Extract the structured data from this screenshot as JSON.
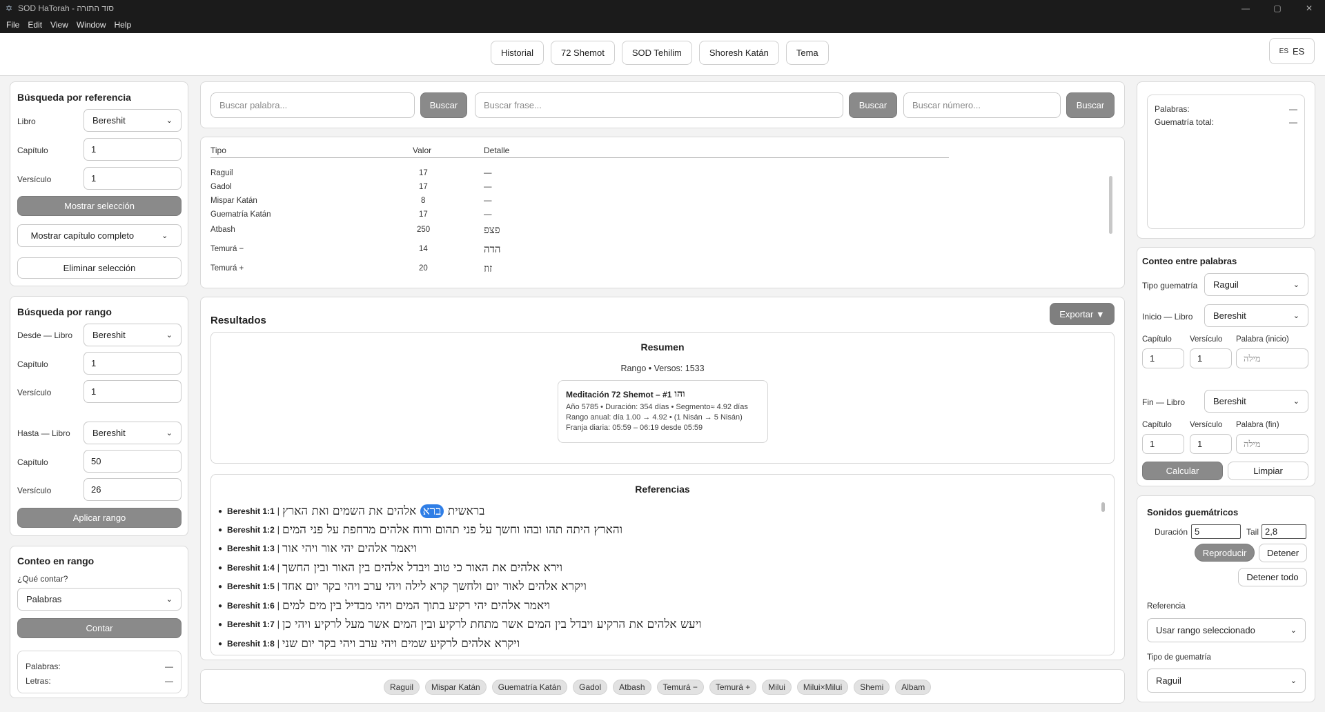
{
  "window": {
    "title": "SOD HaTorah - סוד התורה",
    "minimize": "—",
    "maximize": "▢",
    "close": "✕"
  },
  "menu": [
    "File",
    "Edit",
    "View",
    "Window",
    "Help"
  ],
  "toolbar": {
    "tabs": [
      "Historial",
      "72 Shemot",
      "SOD Tehilim",
      "Shoresh Katán",
      "Tema"
    ],
    "lang_flag": "ES",
    "lang_label": "ES"
  },
  "ref_search": {
    "title": "Búsqueda por referencia",
    "libro_label": "Libro",
    "libro_value": "Bereshit",
    "capitulo_label": "Capítulo",
    "capitulo_value": "1",
    "versiculo_label": "Versículo",
    "versiculo_value": "1",
    "show_button": "Mostrar selección",
    "chapter_select": "Mostrar capítulo completo",
    "clear_button": "Eliminar selección"
  },
  "range_search": {
    "title": "Búsqueda por rango",
    "desde_label": "Desde — Libro",
    "desde_value": "Bereshit",
    "capitulo_label": "Capítulo",
    "desde_capitulo": "1",
    "versiculo_label": "Versículo",
    "desde_versiculo": "1",
    "hasta_label": "Hasta — Libro",
    "hasta_value": "Bereshit",
    "hasta_capitulo": "50",
    "hasta_versiculo": "26",
    "apply_button": "Aplicar rango"
  },
  "range_count": {
    "title": "Conteo en rango",
    "question": "¿Qué contar?",
    "select_value": "Palabras",
    "count_button": "Contar",
    "palabras_label": "Palabras:",
    "palabras_value": "—",
    "letras_label": "Letras:",
    "letras_value": "—"
  },
  "search": {
    "word_placeholder": "Buscar palabra...",
    "phrase_placeholder": "Buscar frase...",
    "number_placeholder": "Buscar número...",
    "button": "Buscar"
  },
  "gematria": {
    "headers": [
      "Tipo",
      "Valor",
      "Detalle"
    ],
    "rows": [
      {
        "tipo": "Raguil",
        "valor": "17",
        "detalle": "—"
      },
      {
        "tipo": "Gadol",
        "valor": "17",
        "detalle": "—"
      },
      {
        "tipo": "Mispar Katán",
        "valor": "8",
        "detalle": "—"
      },
      {
        "tipo": "Guematría Katán",
        "valor": "17",
        "detalle": "—"
      },
      {
        "tipo": "Atbash",
        "valor": "250",
        "detalle": "פצפ"
      },
      {
        "tipo": "Temurá −",
        "valor": "14",
        "detalle": "הדה"
      },
      {
        "tipo": "Temurá +",
        "valor": "20",
        "detalle": "זוז"
      }
    ]
  },
  "results": {
    "title": "Resultados",
    "export_button": "Exportar ▼",
    "summary_title": "Resumen",
    "range_text": "Rango • Versos: 1533",
    "meditation": {
      "title": "Meditación 72 Shemot – #1",
      "name": "והו",
      "line1": "Año 5785 • Duración: 354 días • Segmento≈ 4.92 días",
      "line2": "Rango anual: día 1.00 → 4.92 • (1 Nisán → 5 Nisán)",
      "line3": "Franja diaria: 05:59 – 06:19 desde 05:59"
    },
    "references_title": "Referencias",
    "references": [
      {
        "ref": "Bereshit 1:1",
        "sep": "|",
        "verse_before": "בראשית",
        "highlight": "ברא",
        "verse_after": "אלהים את השמים ואת הארץ"
      },
      {
        "ref": "Bereshit 1:2",
        "sep": "|",
        "verse": "והארץ היתה תהו ובהו וחשך על פני תהום ורוח אלהים מרחפת על פני המים"
      },
      {
        "ref": "Bereshit 1:3",
        "sep": "|",
        "verse": "ויאמר אלהים יהי אור ויהי אור"
      },
      {
        "ref": "Bereshit 1:4",
        "sep": "|",
        "verse": "וירא אלהים את האור כי טוב ויבדל אלהים בין האור ובין החשך"
      },
      {
        "ref": "Bereshit 1:5",
        "sep": "|",
        "verse": "ויקרא אלהים לאור יום ולחשך קרא לילה ויהי ערב ויהי בקר יום אחד"
      },
      {
        "ref": "Bereshit 1:6",
        "sep": "|",
        "verse": "ויאמר אלהים יהי רקיע בתוך המים ויהי מבדיל בין מים למים"
      },
      {
        "ref": "Bereshit 1:7",
        "sep": "|",
        "verse": "ויעש אלהים את הרקיע ויבדל בין המים אשר מתחת לרקיע ובין המים אשר מעל לרקיע ויהי כן"
      },
      {
        "ref": "Bereshit 1:8",
        "sep": "|",
        "verse": "ויקרא אלהים לרקיע שמים ויהי ערב ויהי בקר יום שני"
      }
    ]
  },
  "chips": [
    "Raguil",
    "Mispar Katán",
    "Guematría Katán",
    "Gadol",
    "Atbash",
    "Temurá −",
    "Temurá +",
    "Milui",
    "Milui×Milui",
    "Shemi",
    "Albam"
  ],
  "summary_right": {
    "palabras_label": "Palabras:",
    "palabras_value": "—",
    "guematria_label": "Guematría total:",
    "guematria_value": "—"
  },
  "word_count": {
    "title": "Conteo entre palabras",
    "tipo_label": "Tipo guematría",
    "tipo_value": "Raguil",
    "inicio_label": "Inicio — Libro",
    "inicio_value": "Bereshit",
    "capitulo_label": "Capítulo",
    "versiculo_label": "Versículo",
    "palabra_inicio_label": "Palabra (inicio)",
    "inicio_capitulo": "1",
    "inicio_versiculo": "1",
    "word_placeholder": "מילה",
    "fin_label": "Fin — Libro",
    "fin_value": "Bereshit",
    "palabra_fin_label": "Palabra (fin)",
    "fin_capitulo": "1",
    "fin_versiculo": "1",
    "calc_button": "Calcular",
    "clear_button": "Limpiar"
  },
  "sounds": {
    "title": "Sonidos guemátricos",
    "duracion_label": "Duración",
    "duracion_value": "5",
    "tail_label": "Tail",
    "tail_value": "2,8",
    "play_button": "Reproducir",
    "stop_button": "Detener",
    "stop_all_button": "Detener todo",
    "referencia_label": "Referencia",
    "referencia_value": "Usar rango seleccionado",
    "tipo_label": "Tipo de guematría",
    "tipo_value": "Raguil"
  }
}
